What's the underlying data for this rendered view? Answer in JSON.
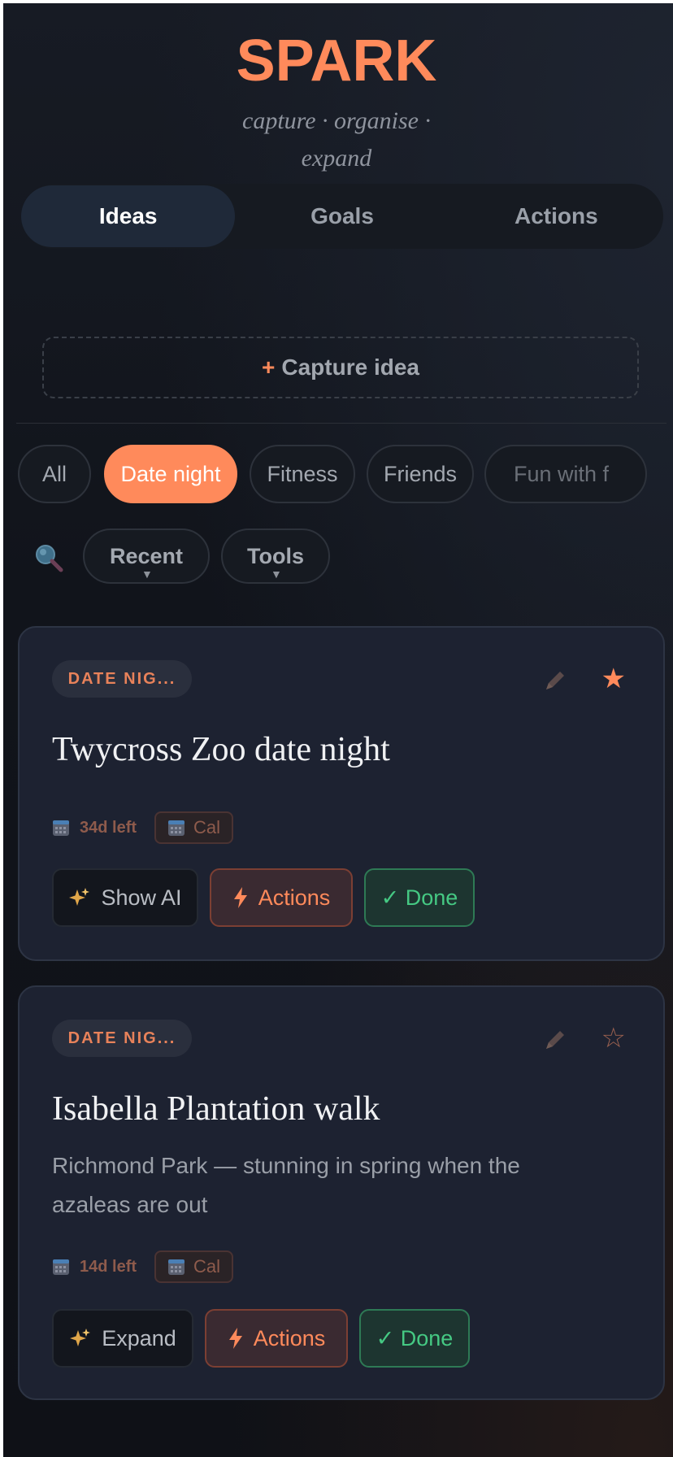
{
  "app": {
    "title": "SPARK",
    "tagline_line1": "capture · organise ·",
    "tagline_line2": "expand"
  },
  "tabs": [
    {
      "label": "Ideas",
      "active": true
    },
    {
      "label": "Goals",
      "active": false
    },
    {
      "label": "Actions",
      "active": false
    }
  ],
  "capture": {
    "plus": "+",
    "label": "Capture idea"
  },
  "filters": [
    {
      "label": "All",
      "active": false
    },
    {
      "label": "Date night",
      "active": true
    },
    {
      "label": "Fitness",
      "active": false
    },
    {
      "label": "Friends",
      "active": false
    },
    {
      "label": "Fun with f",
      "active": false
    }
  ],
  "toolbar": {
    "search_icon": "search-icon",
    "sort_label": "Recent",
    "tools_label": "Tools"
  },
  "cards": [
    {
      "category": "DATE NIG...",
      "starred": true,
      "star_glyph": "★",
      "title": "Twycross Zoo date night",
      "description": "",
      "days_left": "34d left",
      "cal_label": "Cal",
      "ai_label": "Show AI",
      "actions_label": "Actions",
      "done_label": "✓ Done"
    },
    {
      "category": "DATE NIG...",
      "starred": false,
      "star_glyph": "☆",
      "title": "Isabella Plantation walk",
      "description": "Richmond Park — stunning in spring when the azaleas are out",
      "days_left": "14d left",
      "cal_label": "Cal",
      "ai_label": "Expand",
      "actions_label": "Actions",
      "done_label": "✓ Done"
    }
  ],
  "colors": {
    "accent": "#ff8a5b",
    "success": "#45c983",
    "background": "#11141b",
    "card": "#1d2231"
  }
}
